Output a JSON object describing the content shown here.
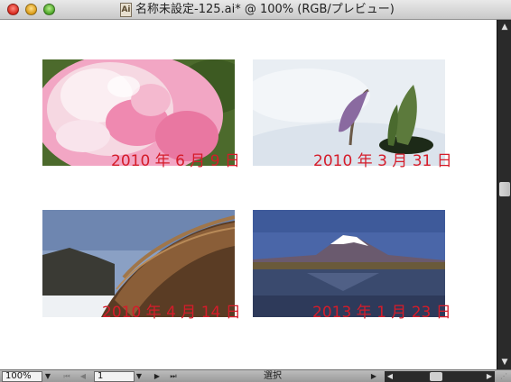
{
  "window": {
    "title": "名称未設定-125.ai* @ 100% (RGB/プレビュー)",
    "doc_icon": "Ai"
  },
  "canvas": {
    "photos": [
      {
        "subject": "pink peony flower",
        "caption": "2010 年 6 月 9 日"
      },
      {
        "subject": "purple flower bud emerging from snow",
        "caption": "2010 年 3 月 31 日"
      },
      {
        "subject": "wooden arched bridge in snow",
        "caption": "2010 年 4 月 14 日"
      },
      {
        "subject": "snow-capped mountain reflected in lake",
        "caption": "2013 年 1 月 23 日"
      }
    ]
  },
  "statusbar": {
    "zoom": "100%",
    "artboard": "1",
    "status": "選択"
  },
  "icons": {
    "first": "first-page-icon",
    "prev": "prev-page-icon",
    "next": "next-page-icon",
    "last": "last-page-icon"
  },
  "colors": {
    "caption": "#d51c2a",
    "scrollbar": "#2a2a2a"
  }
}
